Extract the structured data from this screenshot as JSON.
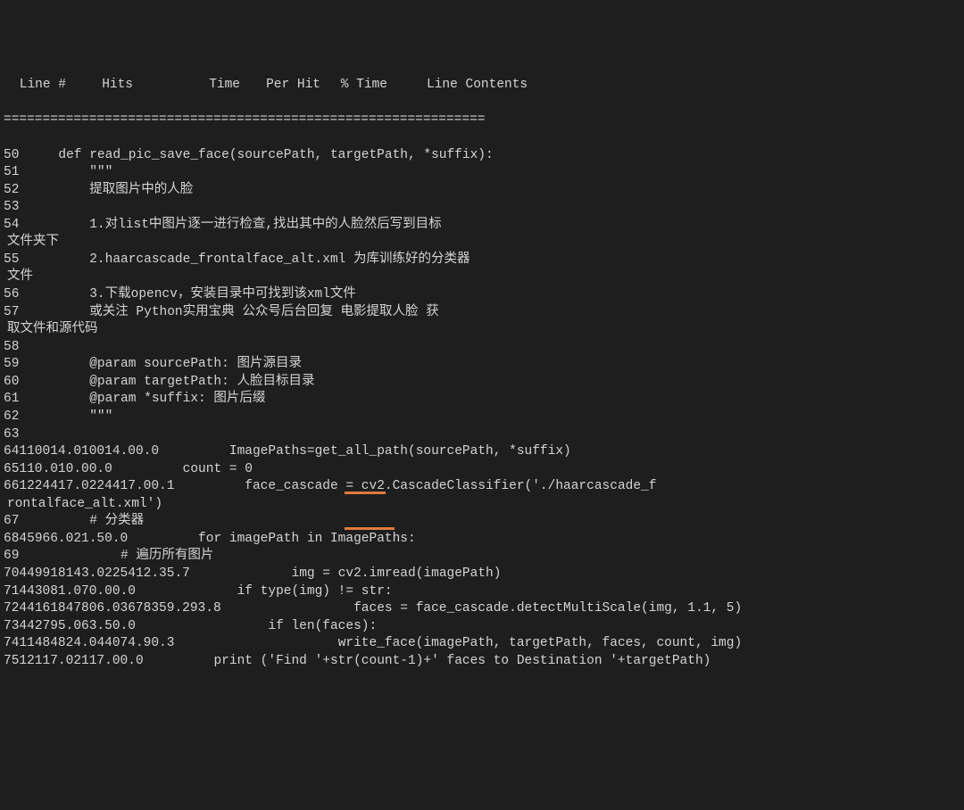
{
  "header": {
    "line": "Line #",
    "hits": "Hits",
    "time": "Time",
    "perhit": "Per Hit",
    "pct": "% Time",
    "contents": "Line Contents"
  },
  "divider": "==============================================================",
  "rows": [
    {
      "n": "50",
      "h": "",
      "t": "",
      "p": "",
      "pct": "",
      "code": "def read_pic_save_face(sourcePath, targetPath, *suffix):"
    },
    {
      "n": "51",
      "h": "",
      "t": "",
      "p": "",
      "pct": "",
      "code": "    \"\"\""
    },
    {
      "n": "52",
      "h": "",
      "t": "",
      "p": "",
      "pct": "",
      "code": "    提取图片中的人脸"
    },
    {
      "n": "53",
      "h": "",
      "t": "",
      "p": "",
      "pct": "",
      "code": ""
    },
    {
      "n": "54",
      "h": "",
      "t": "",
      "p": "",
      "pct": "",
      "code": "    1.对list中图片逐一进行检查,找出其中的人脸然后写到目标",
      "wrap": "文件夹下"
    },
    {
      "n": "55",
      "h": "",
      "t": "",
      "p": "",
      "pct": "",
      "code": "    2.haarcascade_frontalface_alt.xml 为库训练好的分类器",
      "wrap": "文件"
    },
    {
      "n": "56",
      "h": "",
      "t": "",
      "p": "",
      "pct": "",
      "code": "    3.下载opencv，安装目录中可找到该xml文件"
    },
    {
      "n": "57",
      "h": "",
      "t": "",
      "p": "",
      "pct": "",
      "code": "    或关注 Python实用宝典 公众号后台回复 电影提取人脸 获",
      "wrap": "取文件和源代码"
    },
    {
      "n": "58",
      "h": "",
      "t": "",
      "p": "",
      "pct": "",
      "code": ""
    },
    {
      "n": "59",
      "h": "",
      "t": "",
      "p": "",
      "pct": "",
      "code": "    @param sourcePath: 图片源目录"
    },
    {
      "n": "60",
      "h": "",
      "t": "",
      "p": "",
      "pct": "",
      "code": "    @param targetPath: 人脸目标目录"
    },
    {
      "n": "61",
      "h": "",
      "t": "",
      "p": "",
      "pct": "",
      "code": "    @param *suffix: 图片后缀"
    },
    {
      "n": "62",
      "h": "",
      "t": "",
      "p": "",
      "pct": "",
      "code": "    \"\"\""
    },
    {
      "n": "63",
      "h": "",
      "t": "",
      "p": "",
      "pct": "",
      "code": ""
    },
    {
      "n": "64",
      "h": "1",
      "t": "10014.0",
      "p": "10014.0",
      "pct": "0.0",
      "code": "    ImagePaths=get_all_path(sourcePath, *suffix)"
    },
    {
      "n": "65",
      "h": "1",
      "t": "10.0",
      "p": "10.0",
      "pct": "0.0",
      "code": "    count = 0"
    },
    {
      "n": "66",
      "h": "1",
      "t": "224417.0",
      "p": "224417.0",
      "pct": "0.1",
      "code": "    face_cascade = cv2.CascadeClassifier('./haarcascade_f",
      "wrap": "rontalface_alt.xml')"
    },
    {
      "n": "67",
      "h": "",
      "t": "",
      "p": "",
      "pct": "",
      "code": "    # 分类器"
    },
    {
      "n": "68",
      "h": "45",
      "t": "966.0",
      "p": "21.5",
      "pct": "0.0",
      "code": "    for imagePath in ImagePaths:"
    },
    {
      "n": "69",
      "h": "",
      "t": "",
      "p": "",
      "pct": "",
      "code": "        # 遍历所有图片"
    },
    {
      "n": "70",
      "h": "44",
      "t": "9918143.0",
      "p": "225412.3",
      "pct": "5.7",
      "code": "        img = cv2.imread(imagePath)"
    },
    {
      "n": "71",
      "h": "44",
      "t": "3081.0",
      "p": "70.0",
      "pct": "0.0",
      "code": "        if type(img) != str:"
    },
    {
      "n": "72",
      "h": "44",
      "t": "161847806.0",
      "p": "3678359.2",
      "pct": "93.8",
      "code": "            faces = face_cascade.detectMultiScale(img, 1.1, 5)"
    },
    {
      "n": "73",
      "h": "44",
      "t": "2795.0",
      "p": "63.5",
      "pct": "0.0",
      "code": "            if len(faces):"
    },
    {
      "n": "74",
      "h": "11",
      "t": "484824.0",
      "p": "44074.9",
      "pct": "0.3",
      "code": "                write_face(imagePath, targetPath, faces, count, img)"
    },
    {
      "n": "75",
      "h": "1",
      "t": "2117.0",
      "p": "2117.0",
      "pct": "0.0",
      "code": "    print ('Find '+str(count-1)+' faces to Destination '+targetPath)"
    }
  ]
}
